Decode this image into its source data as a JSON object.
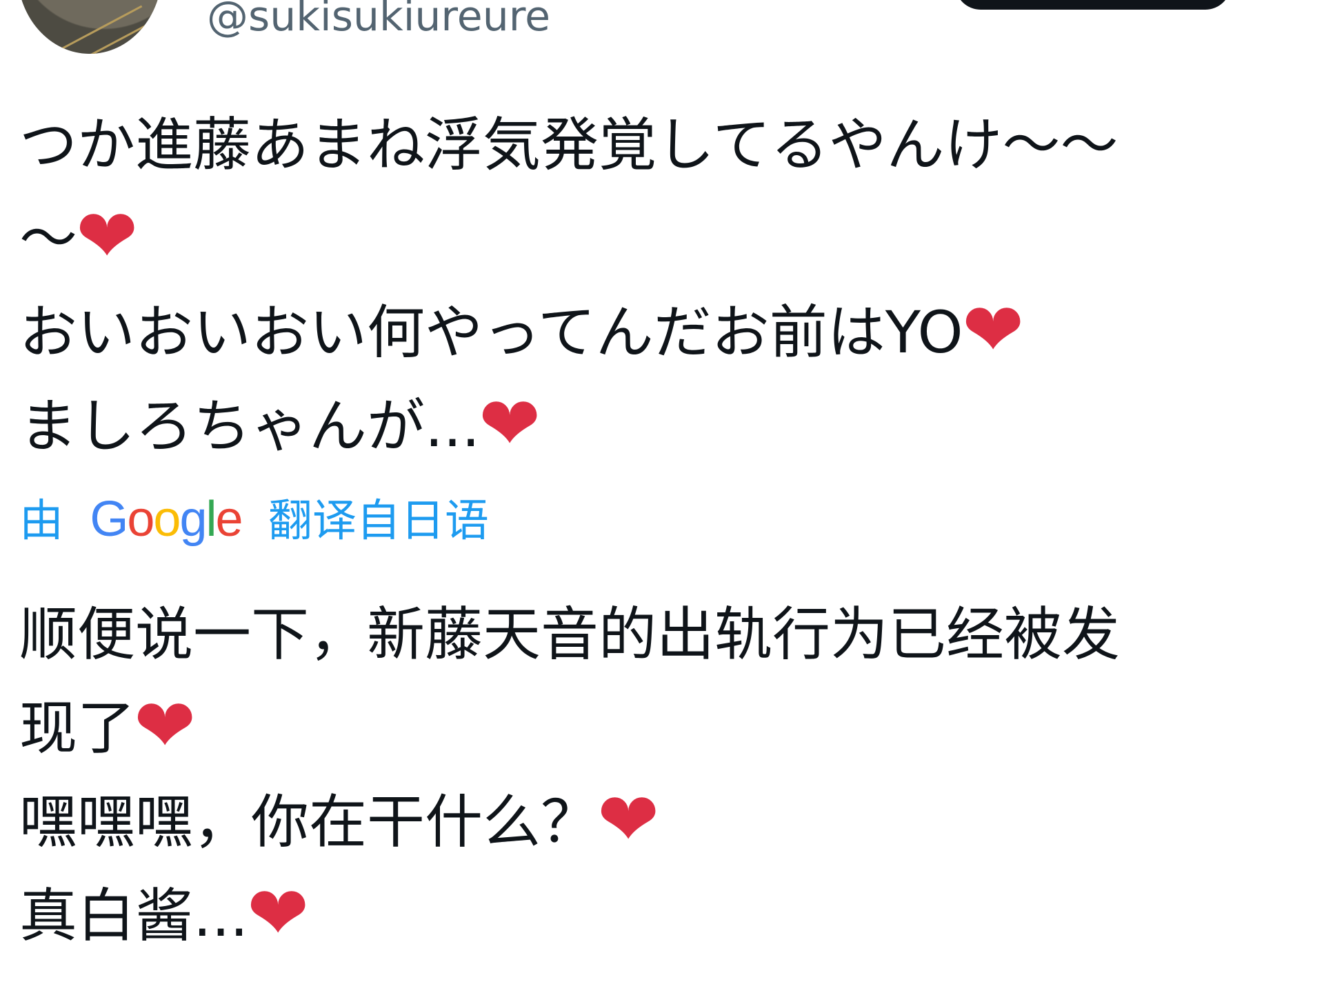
{
  "author": {
    "handle": "@sukisukiureure"
  },
  "tweet": {
    "original_lines": [
      "つか進藤あまね浮気発覚してるやんけ～～",
      "～",
      "おいおいおい何やってんだお前はYO",
      "ましろちゃんが..."
    ],
    "translation_label": {
      "prefix": "由",
      "google": [
        "G",
        "o",
        "o",
        "g",
        "l",
        "e"
      ],
      "suffix": "翻译自日语"
    },
    "translated_lines": [
      "顺便说一下，新藤天音的出轨行为已经被发",
      "现了",
      "嘿嘿嘿，你在干什么？",
      "真白酱..."
    ]
  },
  "icons": {
    "heart": "❤",
    "heart_name": "red-heart-icon"
  },
  "colors": {
    "text": "#0f1419",
    "handle": "#536471",
    "link": "#1d9bf0",
    "heart": "#dd2e44",
    "google_blue": "#4285f4",
    "google_red": "#ea4335",
    "google_yellow": "#fbbc05",
    "google_green": "#34a853"
  }
}
